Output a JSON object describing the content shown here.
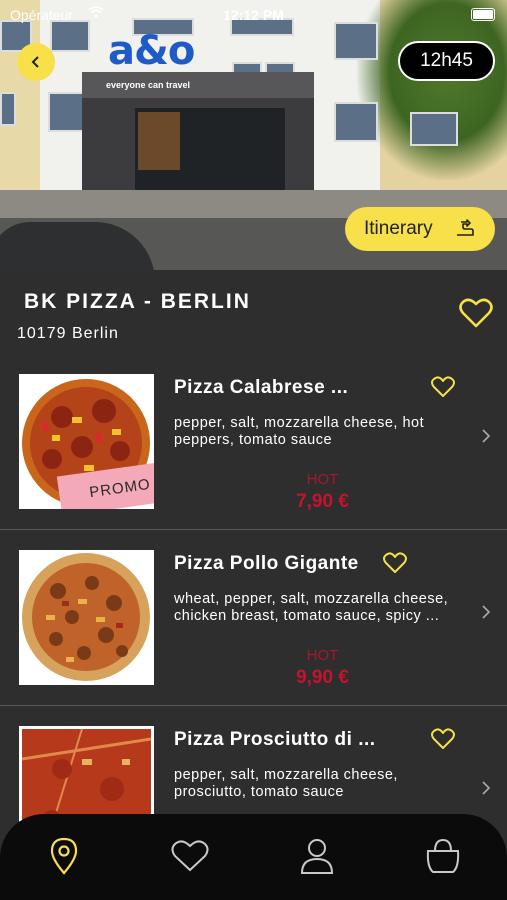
{
  "status_bar": {
    "carrier": "Opérateur",
    "time": "12:12 PM"
  },
  "hero": {
    "logo": "a&o",
    "entrance_sign": "everyone can travel",
    "time_label": "12h45",
    "itinerary_label": "Itinerary"
  },
  "restaurant": {
    "name": "BK PIZZA - BERLIN",
    "address": "10179 Berlin"
  },
  "menu": {
    "items": [
      {
        "title": "Pizza Calabrese ...",
        "description": "pepper, salt, mozzarella cheese, hot peppers, tomato sauce",
        "tag": "HOT",
        "price": "7,90 €",
        "badge": "PROMO"
      },
      {
        "title": "Pizza Pollo Gigante",
        "description": "wheat, pepper, salt, mozzarella cheese, chicken breast, tomato sauce, spicy ...",
        "tag": "HOT",
        "price": "9,90 €",
        "badge": ""
      },
      {
        "title": "Pizza Prosciutto di ...",
        "description": "pepper, salt, mozzarella cheese, prosciutto, tomato sauce",
        "tag": "",
        "price": "",
        "badge": ""
      }
    ]
  },
  "tabbar": {
    "icons": [
      "map-pin-icon",
      "heart-icon",
      "user-icon",
      "basket-icon"
    ]
  },
  "colors": {
    "accent_yellow": "#f7e04a",
    "price_red": "#c4132e",
    "background": "#2e2e2e",
    "tabbar": "#0b0b0b"
  }
}
